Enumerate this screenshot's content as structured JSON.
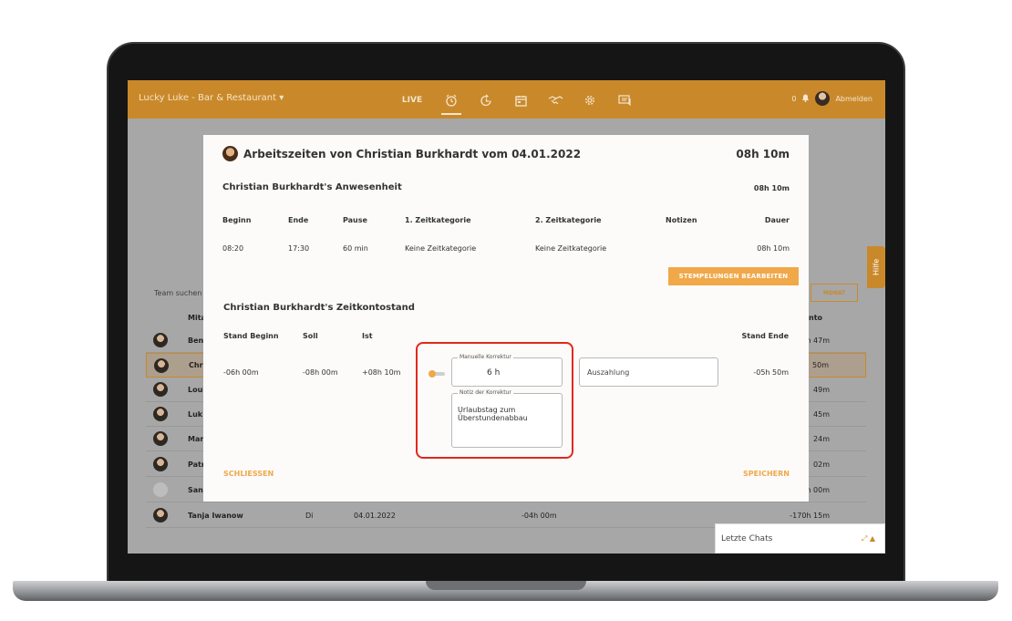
{
  "header": {
    "app_title": "Lucky Luke - Bar & Restaurant ▾",
    "nav": [
      {
        "label": "LIVE",
        "icon": ""
      },
      {
        "label": "",
        "icon": "alarm-clock-icon"
      },
      {
        "label": "",
        "icon": "clock-rotate-icon"
      },
      {
        "label": "",
        "icon": "calendar-icon"
      },
      {
        "label": "",
        "icon": "handshake-icon"
      },
      {
        "label": "",
        "icon": "gear-icon"
      },
      {
        "label": "",
        "icon": "chat-icon"
      }
    ],
    "notifications": "0",
    "logout": "Abmelden"
  },
  "background": {
    "team_search": "Team suchen",
    "monat": "MONAT",
    "col_member": "Mita",
    "col_konto": "nto",
    "rows": [
      {
        "name": "Ben",
        "day": "",
        "date": "",
        "mid": "",
        "konto": "h 47m"
      },
      {
        "name": "Chri",
        "day": "",
        "date": "",
        "mid": "",
        "konto": "50m"
      },
      {
        "name": "Loui",
        "day": "",
        "date": "",
        "mid": "",
        "konto": "49m"
      },
      {
        "name": "Luk",
        "day": "",
        "date": "",
        "mid": "",
        "konto": "45m"
      },
      {
        "name": "Mar",
        "day": "",
        "date": "",
        "mid": "",
        "konto": "24m"
      },
      {
        "name": "Patr",
        "day": "",
        "date": "",
        "mid": "",
        "konto": "02m"
      },
      {
        "name": "San",
        "day": "",
        "date": "",
        "mid": "",
        "konto": "h 00m"
      },
      {
        "name": "Tanja Iwanow",
        "day": "Di",
        "date": "04.01.2022",
        "mid": "-04h 00m",
        "konto": "-170h 15m"
      }
    ],
    "chats_label": "Letzte Chats",
    "hilfe": "Hilfe"
  },
  "modal": {
    "title": "Arbeitszeiten von Christian Burkhardt vom 04.01.2022",
    "total": "08h 10m",
    "presence": {
      "title": "Christian Burkhardt's Anwesenheit",
      "total": "08h 10m",
      "headers": [
        "Beginn",
        "Ende",
        "Pause",
        "1. Zeitkategorie",
        "2. Zeitkategorie",
        "Notizen",
        "Dauer"
      ],
      "row": [
        "08:20",
        "17:30",
        "60 min",
        "Keine Zeitkategorie",
        "Keine Zeitkategorie",
        "",
        "08h 10m"
      ]
    },
    "edit_button": "STEMPELUNGEN BEARBEITEN",
    "account": {
      "title": "Christian Burkhardt's Zeitkontostand",
      "headers": {
        "start": "Stand Beginn",
        "soll": "Soll",
        "ist": "Ist",
        "end": "Stand Ende"
      },
      "values": {
        "start": "-06h 00m",
        "soll": "-08h 00m",
        "ist": "+08h 10m",
        "end": "-05h 50m"
      },
      "manual_label": "Manuelle Korrektur",
      "manual_value": "6  h",
      "note_label": "Notiz der Korrektur",
      "note_value": "Urlaubstag zum Überstundenabbau",
      "payout": "Auszahlung"
    },
    "close": "SCHLIESSEN",
    "save": "SPEICHERN"
  }
}
